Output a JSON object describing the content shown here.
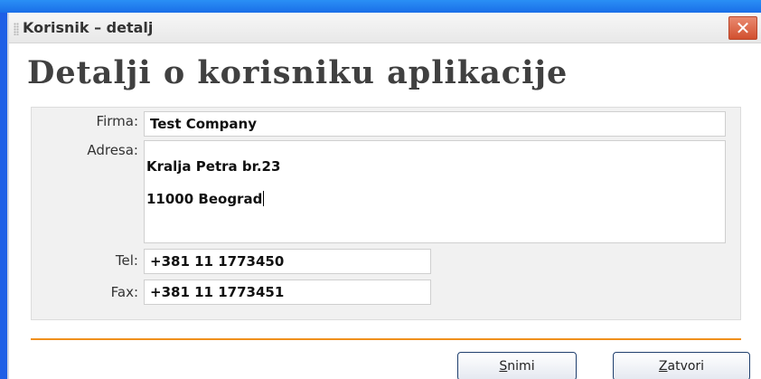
{
  "window": {
    "title": "Korisnik – detalj",
    "close_glyph": "✕"
  },
  "heading": "Detalji o korisniku aplikacije",
  "form": {
    "firma": {
      "label": "Firma:",
      "value": "Test Company"
    },
    "adresa": {
      "label": "Adresa:",
      "line1": "Kralja Petra br.23",
      "line2": "11000 Beograd"
    },
    "tel": {
      "label": "Tel:",
      "value": "+381 11 1773450"
    },
    "fax": {
      "label": "Fax:",
      "value": "+381 11 1773451"
    }
  },
  "buttons": {
    "save": {
      "mnemonic": "S",
      "rest": "nimi"
    },
    "close": {
      "mnemonic": "Z",
      "rest": "atvori"
    }
  },
  "colors": {
    "divider": "#f0901c",
    "close_button": "#d2502f"
  }
}
